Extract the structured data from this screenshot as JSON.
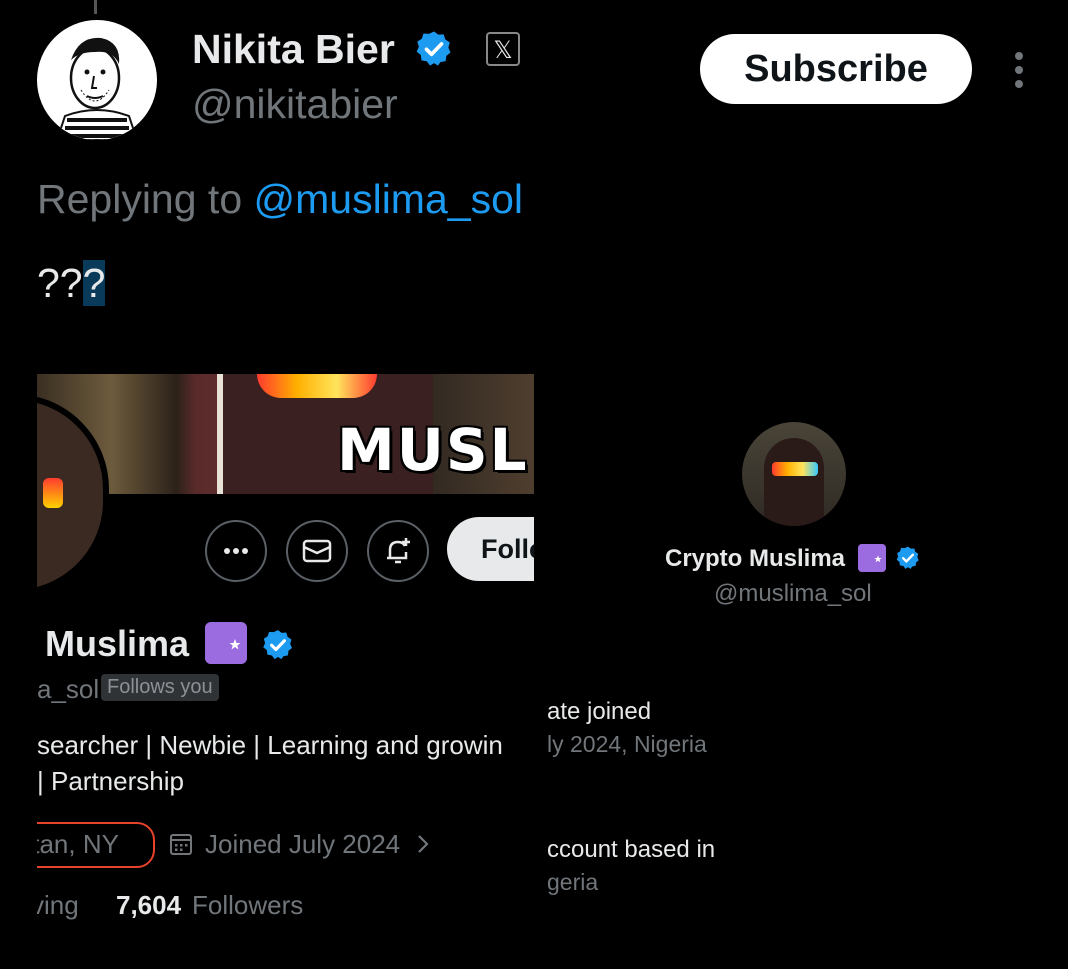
{
  "post": {
    "author_name": "Nikita Bier",
    "author_handle": "@nikitabier",
    "x_badge": "𝕏",
    "subscribe_label": "Subscribe",
    "replying_to_prefix": "Replying to ",
    "replying_to_handle": "@muslima_sol",
    "text_plain": "??",
    "text_selected": "?"
  },
  "left_screenshot": {
    "banner_text": "MUSL",
    "follow_label": "Follo",
    "display_name": "Muslima",
    "handle_fragment": "a_sol",
    "follows_you": "Follows you",
    "bio_line1": "searcher | Newbie | Learning and growin",
    "bio_line2": "| Partnership",
    "location_fragment": "ttan, NY",
    "joined": "Joined July 2024",
    "following_fragment": "ving",
    "followers_count": "7,604",
    "followers_label": "Followers"
  },
  "right_screenshot": {
    "display_name": "Crypto Muslima",
    "handle": "@muslima_sol",
    "date_joined_label": "ate joined",
    "date_joined_value": "ly 2024, Nigeria",
    "account_based_label": "ccount based in",
    "account_based_value": "geria"
  },
  "colors": {
    "background": "#000000",
    "accent_blue": "#1d9bf0",
    "secondary_text": "#71767b",
    "primary_text": "#e7e9ea",
    "location_outline": "#e8412c",
    "badge_purple": "#9b6be0"
  }
}
